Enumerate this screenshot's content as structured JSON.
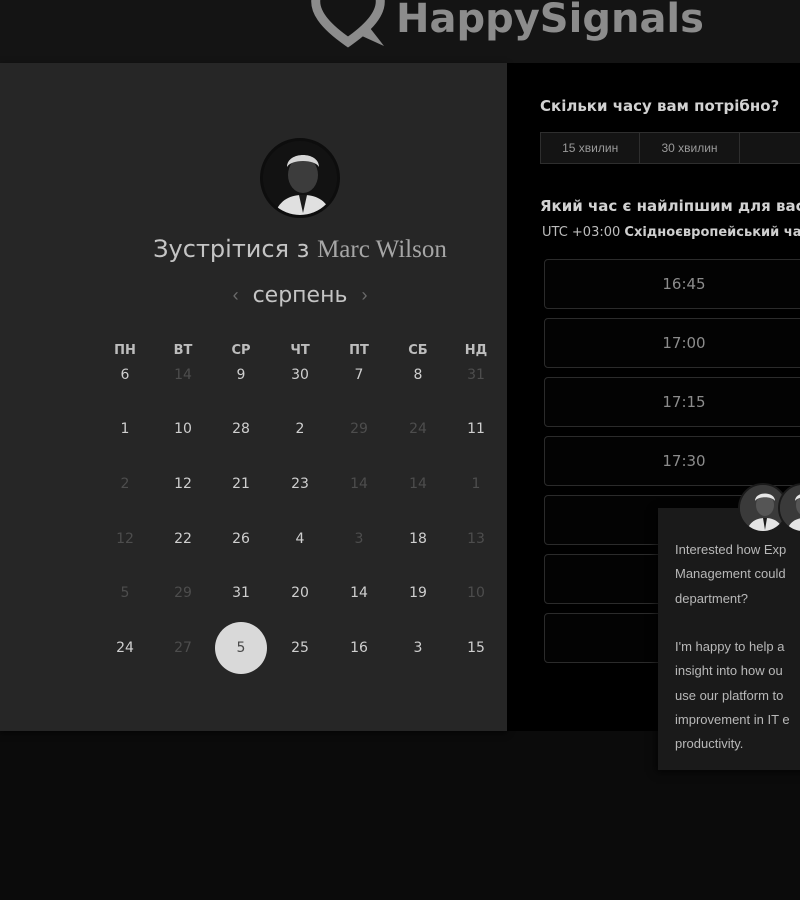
{
  "header": {
    "logo_text": "HappySignals"
  },
  "host": {
    "prefix": "Зустрітися з",
    "name": "Marc Wilson"
  },
  "calendar": {
    "month": "серпень",
    "prev_icon": "chevron-left-icon",
    "next_icon": "chevron-right-icon",
    "weekdays": [
      "ПН",
      "ВТ",
      "СР",
      "ЧТ",
      "ПТ",
      "СБ",
      "НД"
    ],
    "rows": [
      [
        {
          "d": "6",
          "s": "on"
        },
        {
          "d": "14",
          "s": "off"
        },
        {
          "d": "9",
          "s": "on"
        },
        {
          "d": "30",
          "s": "on"
        },
        {
          "d": "7",
          "s": "on"
        },
        {
          "d": "8",
          "s": "on"
        },
        {
          "d": "31",
          "s": "off"
        }
      ],
      [
        {
          "d": "1",
          "s": "on"
        },
        {
          "d": "10",
          "s": "on"
        },
        {
          "d": "28",
          "s": "on"
        },
        {
          "d": "2",
          "s": "on"
        },
        {
          "d": "29",
          "s": "off"
        },
        {
          "d": "24",
          "s": "off"
        },
        {
          "d": "11",
          "s": "on"
        }
      ],
      [
        {
          "d": "2",
          "s": "off"
        },
        {
          "d": "12",
          "s": "on"
        },
        {
          "d": "21",
          "s": "on"
        },
        {
          "d": "23",
          "s": "on"
        },
        {
          "d": "14",
          "s": "off"
        },
        {
          "d": "14",
          "s": "off"
        },
        {
          "d": "1",
          "s": "off"
        }
      ],
      [
        {
          "d": "12",
          "s": "off"
        },
        {
          "d": "22",
          "s": "on"
        },
        {
          "d": "26",
          "s": "on"
        },
        {
          "d": "4",
          "s": "on"
        },
        {
          "d": "3",
          "s": "off"
        },
        {
          "d": "18",
          "s": "on"
        },
        {
          "d": "13",
          "s": "off"
        }
      ],
      [
        {
          "d": "5",
          "s": "off"
        },
        {
          "d": "29",
          "s": "off"
        },
        {
          "d": "31",
          "s": "on"
        },
        {
          "d": "20",
          "s": "on"
        },
        {
          "d": "14",
          "s": "on"
        },
        {
          "d": "19",
          "s": "on"
        },
        {
          "d": "10",
          "s": "off"
        }
      ],
      [
        {
          "d": "24",
          "s": "on"
        },
        {
          "d": "27",
          "s": "off"
        },
        {
          "d": "5",
          "s": "sel"
        },
        {
          "d": "25",
          "s": "on"
        },
        {
          "d": "16",
          "s": "on"
        },
        {
          "d": "3",
          "s": "on"
        },
        {
          "d": "15",
          "s": "on"
        }
      ]
    ]
  },
  "booking": {
    "duration_question": "Скільки часу вам потрібно?",
    "durations": [
      "15 хвилин",
      "30 хвилин",
      ""
    ],
    "time_question": "Який час є найліпшим для вас?",
    "tz_offset": "UTC +03:00",
    "tz_name": "Східноєвропейський ча",
    "slots": [
      "16:45",
      "17:00",
      "17:15",
      "17:30",
      "",
      "",
      ""
    ]
  },
  "chat": {
    "message": "Interested how Exp\nManagement could\ndepartment?\n\nI'm happy to help a\ninsight into how ou\nuse our platform to\nimprovement in IT e\nproductivity."
  },
  "colors": {
    "page_bg": "#0b0b0b",
    "left_panel_bg": "#262626",
    "right_panel_bg": "#000000",
    "selected_day_bg": "#d9d9d9",
    "logo_color": "#8c8c8c"
  }
}
